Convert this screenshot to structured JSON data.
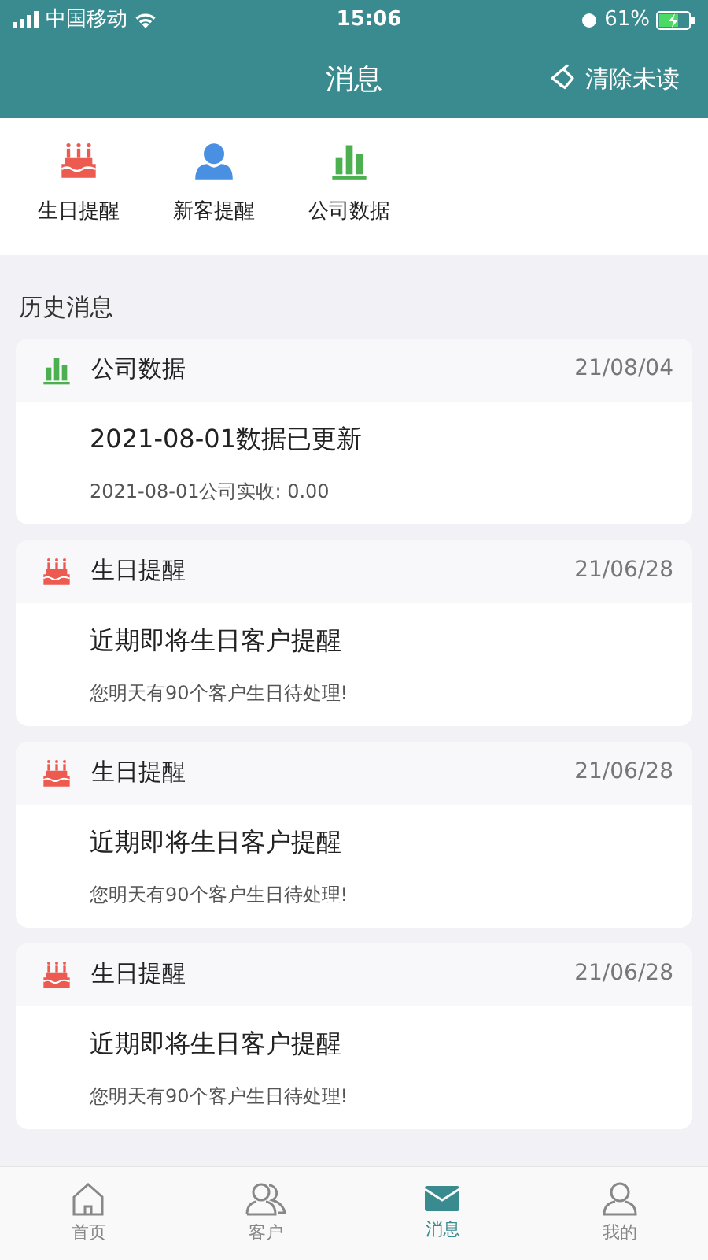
{
  "status_bar": {
    "carrier": "中国移动",
    "time": "15:06",
    "battery": "61%"
  },
  "header": {
    "title": "消息",
    "action": "清除未读"
  },
  "shortcuts": [
    {
      "kind": "birthday",
      "label": "生日提醒"
    },
    {
      "kind": "customer",
      "label": "新客提醒"
    },
    {
      "kind": "data",
      "label": "公司数据"
    }
  ],
  "history": {
    "heading": "历史消息",
    "messages": [
      {
        "kind": "data",
        "category": "公司数据",
        "date": "21/08/04",
        "title": "2021-08-01数据已更新",
        "detail": "2021-08-01公司实收: 0.00"
      },
      {
        "kind": "birthday",
        "category": "生日提醒",
        "date": "21/06/28",
        "title": "近期即将生日客户提醒",
        "detail": "您明天有90个客户生日待处理!"
      },
      {
        "kind": "birthday",
        "category": "生日提醒",
        "date": "21/06/28",
        "title": "近期即将生日客户提醒",
        "detail": "您明天有90个客户生日待处理!"
      },
      {
        "kind": "birthday",
        "category": "生日提醒",
        "date": "21/06/28",
        "title": "近期即将生日客户提醒",
        "detail": "您明天有90个客户生日待处理!"
      }
    ]
  },
  "tab_bar": [
    {
      "kind": "home",
      "label": "首页",
      "selected": false
    },
    {
      "kind": "customers",
      "label": "客户",
      "selected": false
    },
    {
      "kind": "messages",
      "label": "消息",
      "selected": true
    },
    {
      "kind": "me",
      "label": "我的",
      "selected": false
    }
  ]
}
